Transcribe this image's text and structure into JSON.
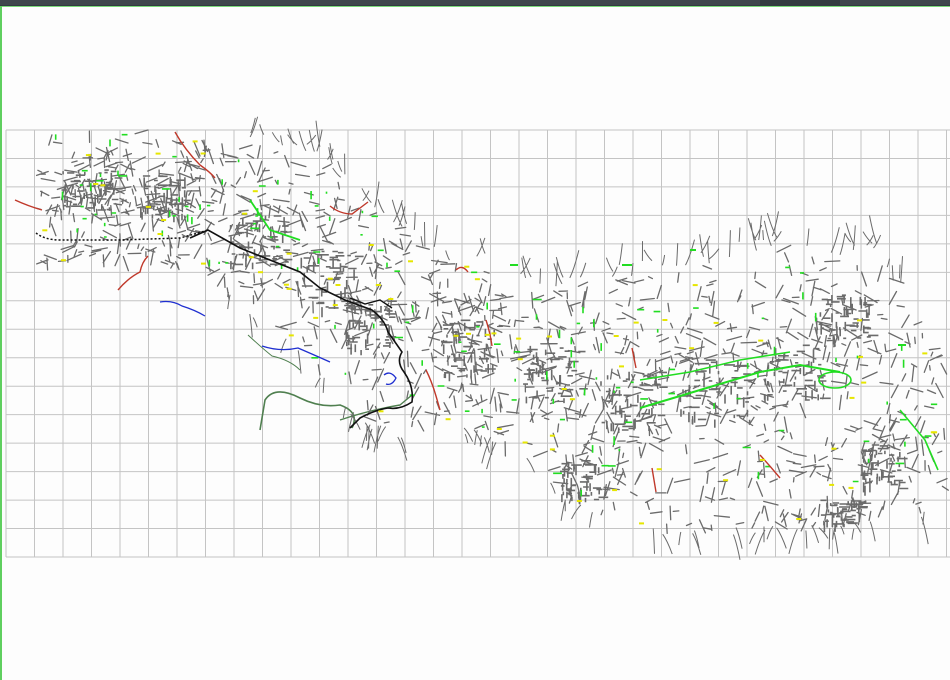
{
  "viewer": {
    "background_color": "#fdfdfd",
    "frame_color": "#5fcf5f",
    "title_strip_color": "#333a40"
  },
  "drawing": {
    "grid": {
      "visible": true,
      "columns": 33,
      "rows": 15,
      "line_color": "#c4c4c4"
    },
    "layers": [
      {
        "name": "streets",
        "color": "#6b6b6b"
      },
      {
        "name": "green-areas",
        "color": "#22dd22"
      },
      {
        "name": "rivers",
        "color": "#1f2fd0"
      },
      {
        "name": "roads-red",
        "color": "#c0392b"
      },
      {
        "name": "railway",
        "color": "#111111"
      },
      {
        "name": "contours",
        "color": "#4f7f4f"
      },
      {
        "name": "labels-yellow",
        "color": "#e6e600"
      }
    ]
  }
}
